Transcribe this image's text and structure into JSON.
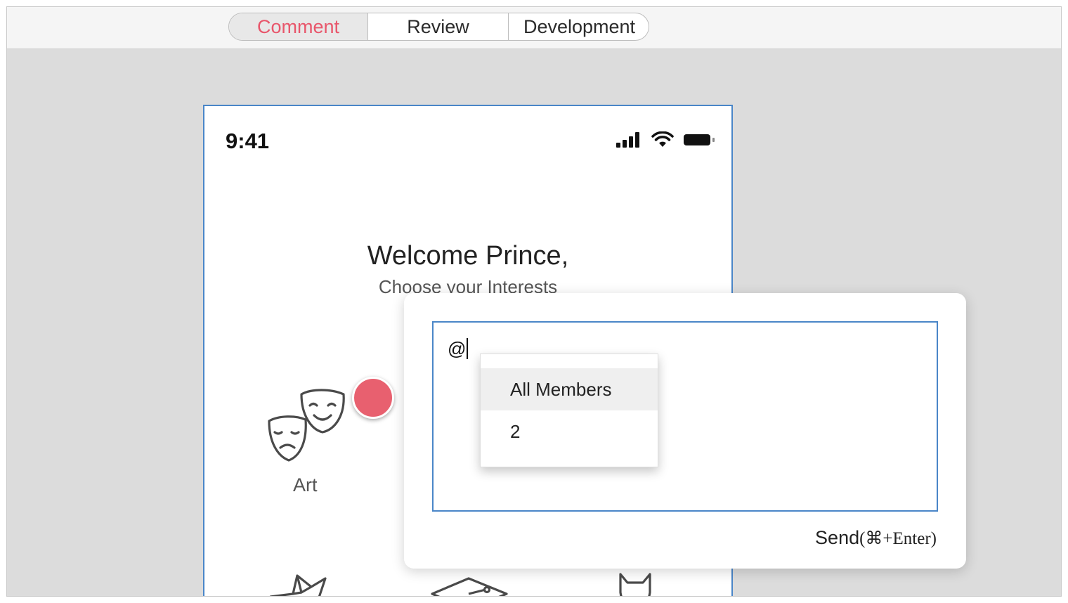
{
  "toolbar": {
    "tabs": [
      {
        "label": "Comment",
        "active": true
      },
      {
        "label": "Review",
        "active": false
      },
      {
        "label": "Development",
        "active": false
      }
    ]
  },
  "phone": {
    "status": {
      "time": "9:41",
      "icons": [
        "cellular-signal-icon",
        "wifi-icon",
        "battery-icon"
      ]
    },
    "welcome": "Welcome Prince,",
    "subtitle": "Choose your Interests",
    "categories": [
      {
        "label": "Art",
        "icon": "theater-masks-icon"
      }
    ],
    "partial_icons": [
      "origami-bird-icon",
      "graduation-cap-icon",
      "cat-icon"
    ]
  },
  "comment": {
    "input_value": "@",
    "mention_options": [
      {
        "label": "All Members",
        "highlighted": true
      },
      {
        "label": "2",
        "highlighted": false
      }
    ],
    "send_label": "Send",
    "send_shortcut": "(⌘+Enter)"
  },
  "colors": {
    "accent": "#e8566b",
    "pin": "#e8606f",
    "focus_border": "#4a86c8"
  }
}
